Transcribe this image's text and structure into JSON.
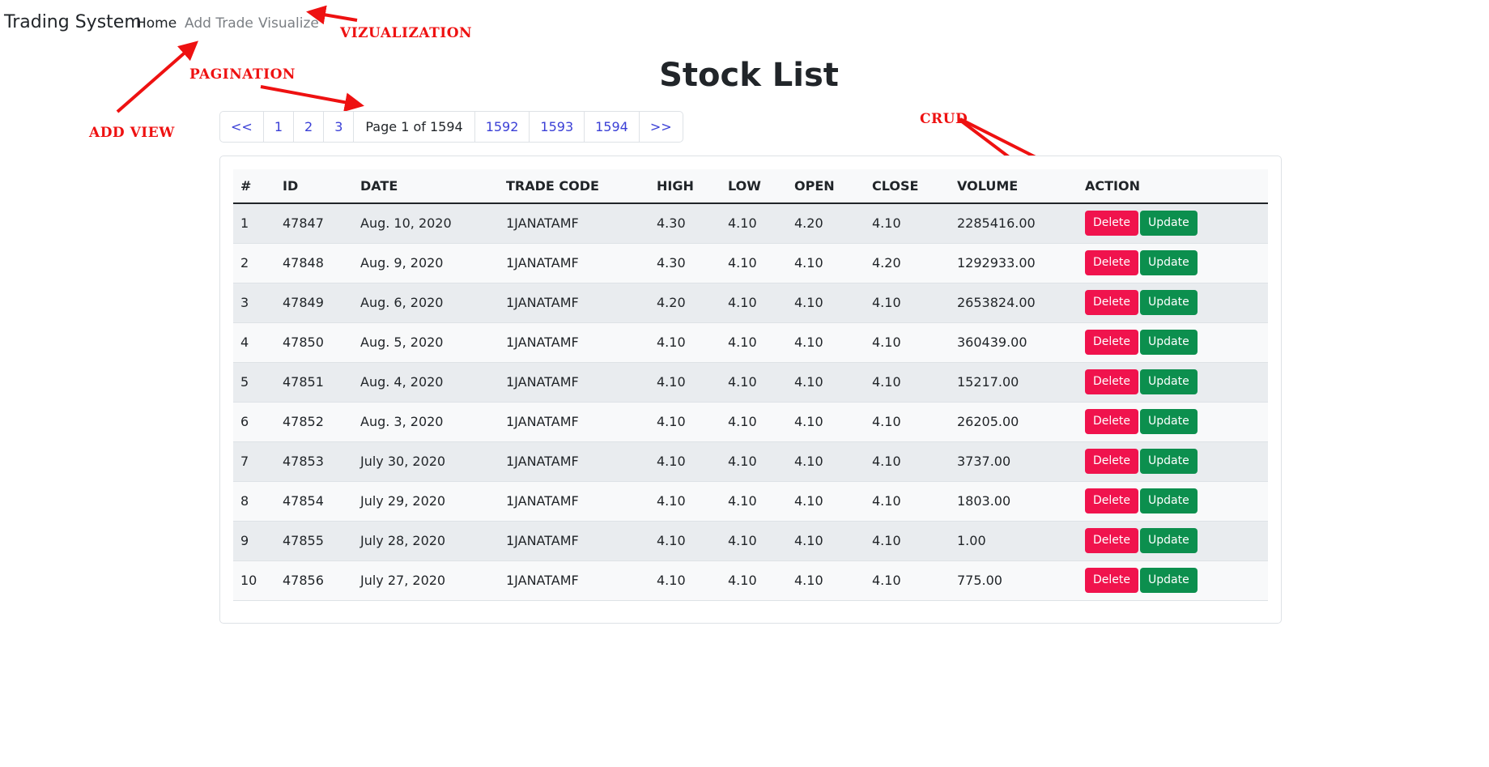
{
  "navbar": {
    "brand": "Trading System",
    "links": {
      "home": "Home",
      "add_trade": "Add Trade",
      "visualize": "Visualize"
    }
  },
  "annotations": {
    "vizualization": "VIZUALIZATION",
    "pagination": "PAGINATION",
    "add_view": "ADD VIEW",
    "crud": "CRUD",
    "color": "#ee1111"
  },
  "page_title": "Stock List",
  "pagination": {
    "first": "<<",
    "p1": "1",
    "p2": "2",
    "p3": "3",
    "current": "Page 1 of 1594",
    "p1592": "1592",
    "p1593": "1593",
    "p1594": "1594",
    "last": ">>"
  },
  "table": {
    "headers": [
      "#",
      "ID",
      "DATE",
      "TRADE CODE",
      "HIGH",
      "LOW",
      "OPEN",
      "CLOSE",
      "VOLUME",
      "ACTION"
    ],
    "delete_label": "Delete",
    "update_label": "Update",
    "rows": [
      [
        "1",
        "47847",
        "Aug. 10, 2020",
        "1JANATAMF",
        "4.30",
        "4.10",
        "4.20",
        "4.10",
        "2285416.00"
      ],
      [
        "2",
        "47848",
        "Aug. 9, 2020",
        "1JANATAMF",
        "4.30",
        "4.10",
        "4.10",
        "4.20",
        "1292933.00"
      ],
      [
        "3",
        "47849",
        "Aug. 6, 2020",
        "1JANATAMF",
        "4.20",
        "4.10",
        "4.10",
        "4.10",
        "2653824.00"
      ],
      [
        "4",
        "47850",
        "Aug. 5, 2020",
        "1JANATAMF",
        "4.10",
        "4.10",
        "4.10",
        "4.10",
        "360439.00"
      ],
      [
        "5",
        "47851",
        "Aug. 4, 2020",
        "1JANATAMF",
        "4.10",
        "4.10",
        "4.10",
        "4.10",
        "15217.00"
      ],
      [
        "6",
        "47852",
        "Aug. 3, 2020",
        "1JANATAMF",
        "4.10",
        "4.10",
        "4.10",
        "4.10",
        "26205.00"
      ],
      [
        "7",
        "47853",
        "July 30, 2020",
        "1JANATAMF",
        "4.10",
        "4.10",
        "4.10",
        "4.10",
        "3737.00"
      ],
      [
        "8",
        "47854",
        "July 29, 2020",
        "1JANATAMF",
        "4.10",
        "4.10",
        "4.10",
        "4.10",
        "1803.00"
      ],
      [
        "9",
        "47855",
        "July 28, 2020",
        "1JANATAMF",
        "4.10",
        "4.10",
        "4.10",
        "4.10",
        "1.00"
      ],
      [
        "10",
        "47856",
        "July 27, 2020",
        "1JANATAMF",
        "4.10",
        "4.10",
        "4.10",
        "4.10",
        "775.00"
      ]
    ]
  },
  "colors": {
    "delete": "#f0134d",
    "update": "#0c8f4e",
    "link": "#3a3fd6"
  }
}
